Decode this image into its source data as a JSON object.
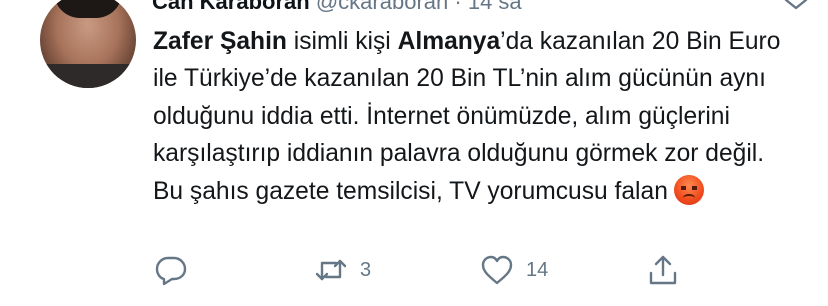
{
  "tweet": {
    "author_name": "Can Karaboran",
    "author_handle": "@ckaraboran",
    "separator": "·",
    "time": "14 sa",
    "text_parts": [
      {
        "text": "Zafer Şahin",
        "bold": true
      },
      {
        "text": " isimli kişi ",
        "bold": false
      },
      {
        "text": "Almanya",
        "bold": true
      },
      {
        "text": "’da kazanılan 20 Bin Euro ile Türkiye’de kazanılan 20 Bin TL’nin alım gücünün aynı olduğunu iddia etti. İnternet önümüzde, alım güçlerini karşılaştırıp iddianın palavra olduğunu görmek zor değil. Bu şahıs gazete temsilcisi, TV yorumcusu falan",
        "bold": false
      }
    ],
    "emoji": "pouting-face-emoji"
  },
  "actions": {
    "reply_count": "",
    "retweet_count": "3",
    "like_count": "14"
  },
  "icons": {
    "reply": "reply-icon",
    "retweet": "retweet-icon",
    "like": "heart-icon",
    "share": "share-icon",
    "menu": "chevron-down-icon"
  },
  "colors": {
    "text": "#14171a",
    "secondary": "#657786"
  }
}
